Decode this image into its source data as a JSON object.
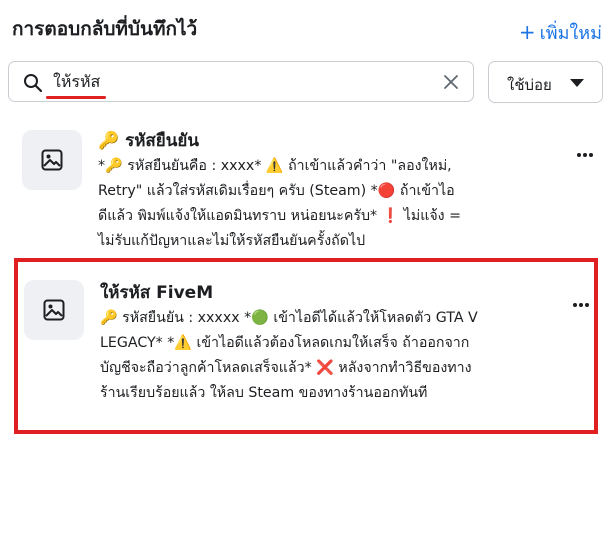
{
  "header": {
    "title": "การตอบกลับที่บันทึกไว้",
    "add_new_label": "เพิ่มใหม่",
    "add_new_plus": "+"
  },
  "search": {
    "value": "ให้รหัส",
    "placeholder": ""
  },
  "sort": {
    "label": "ใช้บ่อย"
  },
  "replies": [
    {
      "title": "🔑 รหัสยืนยัน",
      "lines": [
        "*🔑 รหัสยืนยันคือ : xxxx* ⚠️ ถ้าเข้าแล้วคำว่า \"ลองใหม่,",
        "Retry\" แล้วใส่รหัสเดิมเรื่อยๆ ครับ (Steam) *🔴 ถ้าเข้าไอ",
        "ดีแล้ว พิมพ์แจ้งให้แอดมินทราบ หน่อยนะครับ* ❗ ไม่แจ้ง =",
        "ไม่รับแก้ปัญหาและไม่ให้รหัสยืนยันครั้งถัดไป"
      ]
    },
    {
      "title": "ให้รหัส FiveM",
      "lines": [
        "🔑 รหัสยืนยัน : xxxxx *🟢 เข้าไอดีได้แล้วให้โหลดตัว GTA V",
        "LEGACY* *⚠️ เข้าไอดีแล้วต้องโหลดเกมให้เสร็จ ถ้าออกจาก",
        "บัญชีจะถือว่าลูกค้าโหลดเสร็จแล้ว* ❌ หลังจากทำวิธีของทาง",
        "ร้านเรียบร้อยแล้ว ให้ลบ Steam ของทางร้านออกทันที"
      ]
    }
  ],
  "colors": {
    "accent": "#1b74e4",
    "highlight_border": "#e02020",
    "thumb_bg": "#eef0f3"
  }
}
